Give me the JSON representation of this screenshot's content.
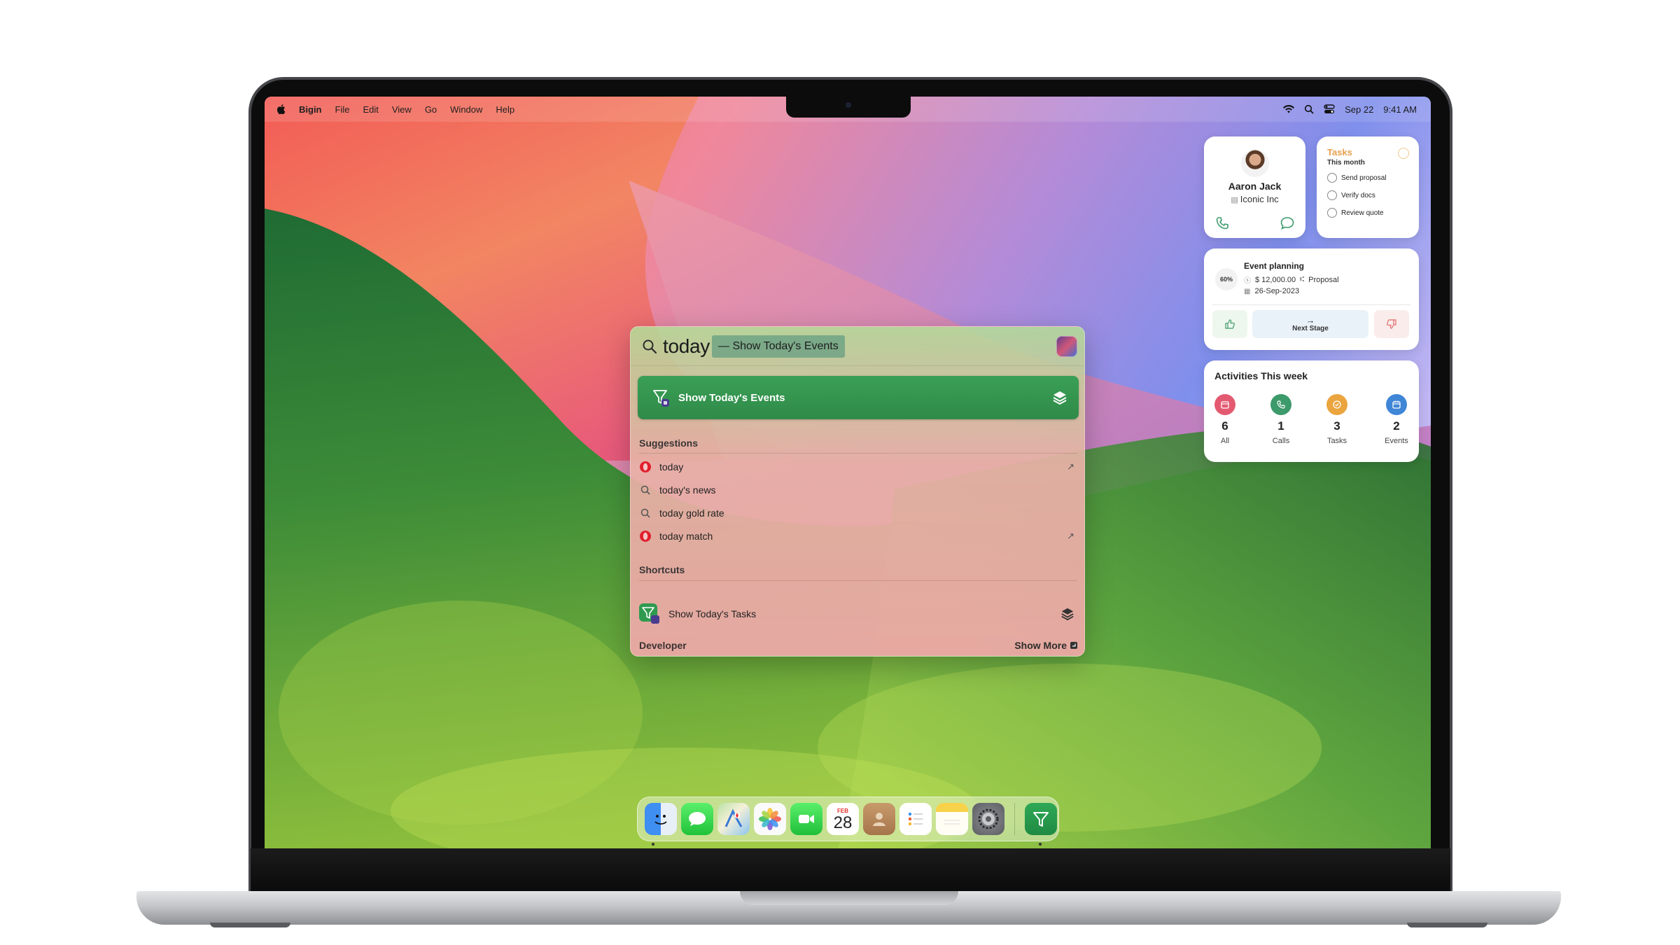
{
  "menubar": {
    "app_name": "Bigin",
    "items": [
      "File",
      "Edit",
      "View",
      "Go",
      "Window",
      "Help"
    ],
    "date": "Sep 22",
    "time": "9:41 AM"
  },
  "spotlight": {
    "query": "today",
    "completion": "— Show Today's Events",
    "top_hit": "Show Today's Events",
    "suggestions_title": "Suggestions",
    "suggestions": [
      {
        "text": "today",
        "icon": "opera-icon"
      },
      {
        "text": "today's news",
        "icon": "search-icon"
      },
      {
        "text": "today gold rate",
        "icon": "search-icon"
      },
      {
        "text": "today match",
        "icon": "opera-icon"
      }
    ],
    "shortcuts_title": "Shortcuts",
    "shortcut": "Show Today's Tasks",
    "footer_left": "Developer",
    "footer_right": "Show More"
  },
  "contact": {
    "name": "Aaron Jack",
    "company": "Iconic Inc"
  },
  "tasks": {
    "title": "Tasks",
    "subtitle": "This month",
    "items": [
      "Send proposal",
      "Verify docs",
      "Review quote"
    ]
  },
  "deal": {
    "progress": "60%",
    "title": "Event planning",
    "amount": "$ 12,000.00",
    "stage": "Proposal",
    "date": "26-Sep-2023",
    "next_label": "Next Stage"
  },
  "activities": {
    "title": "Activities This week",
    "items": [
      {
        "count": "6",
        "label": "All",
        "color": "#e35a70"
      },
      {
        "count": "1",
        "label": "Calls",
        "color": "#3d9a6a"
      },
      {
        "count": "3",
        "label": "Tasks",
        "color": "#eaa53f"
      },
      {
        "count": "2",
        "label": "Events",
        "color": "#3f86d6"
      }
    ]
  },
  "dock": {
    "apps": [
      "finder-icon",
      "messages-icon",
      "maps-icon",
      "photos-icon",
      "facetime-icon",
      "calendar-icon",
      "contacts-icon",
      "reminders-icon",
      "notes-icon",
      "system-settings-icon",
      "bigin-icon"
    ],
    "calendar_month": "FEB",
    "calendar_day": "28"
  }
}
